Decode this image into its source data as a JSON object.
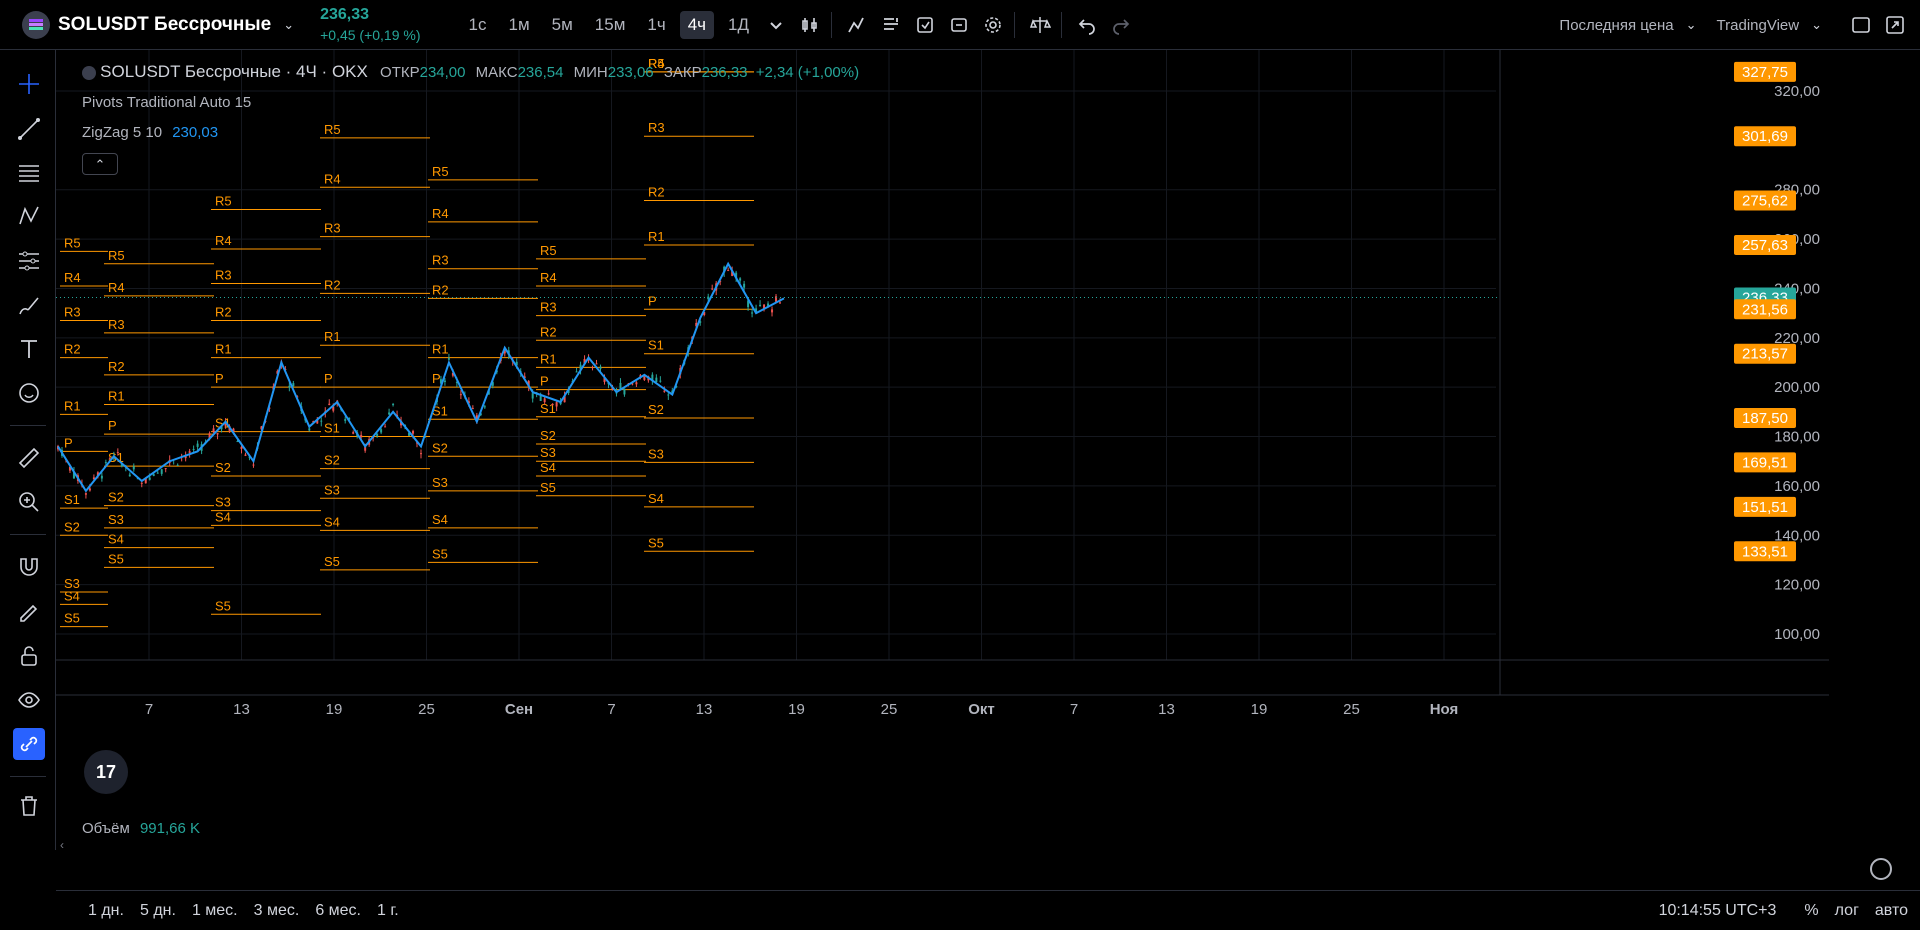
{
  "topbar": {
    "symbol": "SOLUSDT Бессрочные",
    "price": "236,33",
    "change": "+0,45 (+0,19 %)",
    "timeframes": [
      "1с",
      "1м",
      "5м",
      "15м",
      "1ч",
      "4ч",
      "1Д"
    ],
    "active_timeframe": "4ч",
    "price_type": "Последняя цена",
    "source": "TradingView"
  },
  "legend": {
    "symbol_line": "SOLUSDT Бессрочные · 4Ч · OKX",
    "o_label": "ОТКР",
    "o": "234,00",
    "h_label": "МАКС",
    "h": "236,54",
    "l_label": "МИН",
    "l": "233,06",
    "c_label": "ЗАКР",
    "c": "236,33",
    "chg": "+2,34 (+1,00%)",
    "pivots": "Pivots Traditional Auto 15",
    "zigzag": "ZigZag 5 10",
    "zigzag_val": "230,03",
    "volume_label": "Объём",
    "volume_val": "991,66 K"
  },
  "chart_data": {
    "type": "candlestick",
    "yaxis": {
      "ticks": [
        "320,00",
        "280,00",
        "260,00",
        "240,00",
        "220,00",
        "200,00",
        "180,00",
        "160,00",
        "140,00",
        "120,00",
        "100,00"
      ],
      "min": 94,
      "max": 330
    },
    "xaxis_ticks": [
      "7",
      "13",
      "19",
      "25",
      "Сен",
      "7",
      "13",
      "19",
      "25",
      "Окт",
      "7",
      "13",
      "19",
      "25",
      "Ноя"
    ],
    "price_labels": [
      {
        "text": "327,75",
        "value": 327.75,
        "color": "#ff9800"
      },
      {
        "text": "301,69",
        "value": 301.69,
        "color": "#ff9800"
      },
      {
        "text": "275,62",
        "value": 275.62,
        "color": "#ff9800"
      },
      {
        "text": "257,63",
        "value": 257.63,
        "color": "#ff9800"
      },
      {
        "text": "236,33",
        "value": 236.33,
        "color": "#26a69a"
      },
      {
        "text": "231,56",
        "value": 231.56,
        "color": "#ff9800"
      },
      {
        "text": "213,57",
        "value": 213.57,
        "color": "#ff9800"
      },
      {
        "text": "187,50",
        "value": 187.5,
        "color": "#ff9800"
      },
      {
        "text": "169,51",
        "value": 169.51,
        "color": "#ff9800"
      },
      {
        "text": "151,51",
        "value": 151.51,
        "color": "#ff9800"
      },
      {
        "text": "133,51",
        "value": 133.51,
        "color": "#ff9800"
      }
    ],
    "pivot_labels": [
      "R5",
      "R4",
      "R3",
      "R2",
      "R1",
      "P",
      "S1",
      "S2",
      "S3",
      "S4",
      "S5"
    ],
    "zigzag_points": [
      [
        0,
        176
      ],
      [
        1,
        158
      ],
      [
        2,
        172
      ],
      [
        3,
        162
      ],
      [
        4,
        170
      ],
      [
        5,
        174
      ],
      [
        6,
        186
      ],
      [
        7,
        170
      ],
      [
        8,
        210
      ],
      [
        9,
        184
      ],
      [
        10,
        194
      ],
      [
        11,
        176
      ],
      [
        12,
        190
      ],
      [
        13,
        176
      ],
      [
        14,
        210
      ],
      [
        15,
        186
      ],
      [
        16,
        216
      ],
      [
        17,
        198
      ],
      [
        18,
        194
      ],
      [
        19,
        212
      ],
      [
        20,
        198
      ],
      [
        21,
        205
      ],
      [
        22,
        197
      ],
      [
        23,
        228
      ],
      [
        24,
        250
      ],
      [
        25,
        230
      ],
      [
        26,
        236
      ]
    ],
    "current_price": 236.33
  },
  "bottombar": {
    "ranges": [
      "1 дн.",
      "5 дн.",
      "1 мес.",
      "3 мес.",
      "6 мес.",
      "1 г."
    ],
    "time": "10:14:55 UTC+3",
    "pct": "%",
    "log": "лог",
    "auto": "авто"
  }
}
